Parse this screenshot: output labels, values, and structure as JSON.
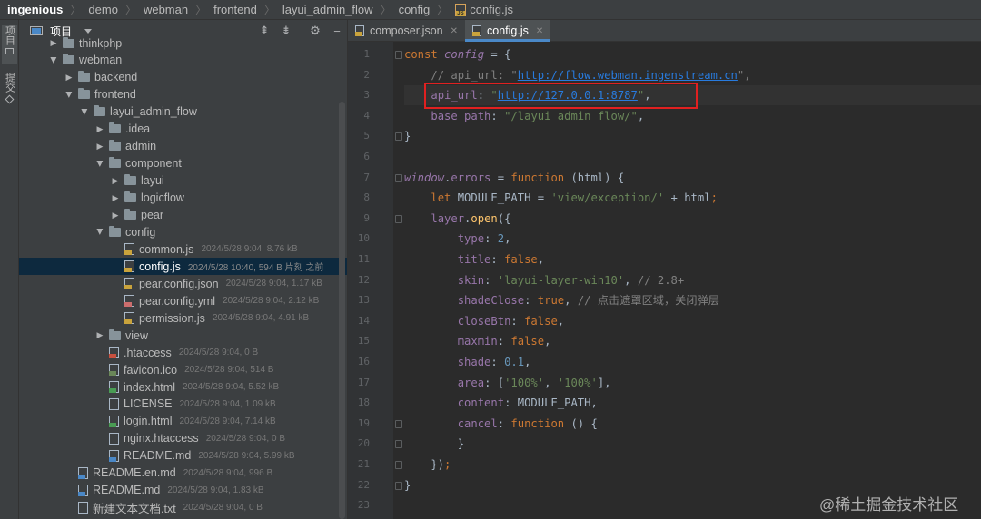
{
  "breadcrumb": [
    "ingenious",
    "demo",
    "webman",
    "frontend",
    "layui_admin_flow",
    "config",
    "config.js"
  ],
  "tool_strip": [
    "项目",
    "提交"
  ],
  "project_panel": {
    "title": "项目",
    "tools": [
      "⇞",
      "⇟",
      "⚙",
      "−"
    ]
  },
  "tree": [
    {
      "name": "thinkphp",
      "meta": "",
      "kind": "folder",
      "depth": 2,
      "open": false
    },
    {
      "name": "webman",
      "meta": "",
      "kind": "folder",
      "depth": 2,
      "open": true
    },
    {
      "name": "backend",
      "meta": "",
      "kind": "folder",
      "depth": 3,
      "open": false
    },
    {
      "name": "frontend",
      "meta": "",
      "kind": "folder",
      "depth": 3,
      "open": true
    },
    {
      "name": "layui_admin_flow",
      "meta": "",
      "kind": "folder",
      "depth": 4,
      "open": true
    },
    {
      "name": ".idea",
      "meta": "",
      "kind": "folder",
      "depth": 5,
      "open": false
    },
    {
      "name": "admin",
      "meta": "",
      "kind": "folder",
      "depth": 5,
      "open": false
    },
    {
      "name": "component",
      "meta": "",
      "kind": "folder",
      "depth": 5,
      "open": true
    },
    {
      "name": "layui",
      "meta": "",
      "kind": "folder",
      "depth": 6,
      "open": false
    },
    {
      "name": "logicflow",
      "meta": "",
      "kind": "folder",
      "depth": 6,
      "open": false
    },
    {
      "name": "pear",
      "meta": "",
      "kind": "folder",
      "depth": 6,
      "open": false
    },
    {
      "name": "config",
      "meta": "",
      "kind": "folder",
      "depth": 5,
      "open": true
    },
    {
      "name": "common.js",
      "meta": "2024/5/28 9:04, 8.76 kB",
      "kind": "js",
      "depth": 6
    },
    {
      "name": "config.js",
      "meta": "2024/5/28 10:40, 594 B 片刻 之前",
      "kind": "js",
      "depth": 6,
      "selected": true
    },
    {
      "name": "pear.config.json",
      "meta": "2024/5/28 9:04, 1.17 kB",
      "kind": "json",
      "depth": 6
    },
    {
      "name": "pear.config.yml",
      "meta": "2024/5/28 9:04, 2.12 kB",
      "kind": "yml",
      "depth": 6
    },
    {
      "name": "permission.js",
      "meta": "2024/5/28 9:04, 4.91 kB",
      "kind": "js",
      "depth": 6
    },
    {
      "name": "view",
      "meta": "",
      "kind": "folder",
      "depth": 5,
      "open": false
    },
    {
      "name": ".htaccess",
      "meta": "2024/5/28 9:04, 0 B",
      "kind": "ht",
      "depth": 5
    },
    {
      "name": "favicon.ico",
      "meta": "2024/5/28 9:04, 514 B",
      "kind": "ico",
      "depth": 5
    },
    {
      "name": "index.html",
      "meta": "2024/5/28 9:04, 5.52 kB",
      "kind": "html",
      "depth": 5
    },
    {
      "name": "LICENSE",
      "meta": "2024/5/28 9:04, 1.09 kB",
      "kind": "txt",
      "depth": 5
    },
    {
      "name": "login.html",
      "meta": "2024/5/28 9:04, 7.14 kB",
      "kind": "html",
      "depth": 5
    },
    {
      "name": "nginx.htaccess",
      "meta": "2024/5/28 9:04, 0 B",
      "kind": "txt",
      "depth": 5
    },
    {
      "name": "README.md",
      "meta": "2024/5/28 9:04, 5.99 kB",
      "kind": "md",
      "depth": 5
    },
    {
      "name": "README.en.md",
      "meta": "2024/5/28 9:04, 996 B",
      "kind": "md",
      "depth": 3
    },
    {
      "name": "README.md",
      "meta": "2024/5/28 9:04, 1.83 kB",
      "kind": "md",
      "depth": 3
    },
    {
      "name": "新建文本文档.txt",
      "meta": "2024/5/28 9:04, 0 B",
      "kind": "txt",
      "depth": 3
    }
  ],
  "tabs": [
    {
      "label": "composer.json",
      "active": false,
      "kind": "json"
    },
    {
      "label": "config.js",
      "active": true,
      "kind": "js"
    }
  ],
  "code_lines": [
    {
      "n": "1",
      "html": "<span class=\"kw\">const </span><span class=\"it\">config</span> = {"
    },
    {
      "n": "2",
      "html": "    <span class=\"cm\">// api_url: \"<span class=\"lk\">http://flow.webman.ingenstream.cn</span>\",</span>"
    },
    {
      "n": "3",
      "html": "    <span class=\"pr\">api_url</span>: <span class=\"st\">\"<span class=\"lk\">http://127.0.0.1:8787</span>\"</span>,",
      "caret": true
    },
    {
      "n": "4",
      "html": "    <span class=\"pr\">base_path</span>: <span class=\"st\">\"/layui_admin_flow/\"</span>,"
    },
    {
      "n": "5",
      "html": "}"
    },
    {
      "n": "6",
      "html": ""
    },
    {
      "n": "7",
      "html": "<span class=\"it\">window</span>.<span class=\"pr\">errors</span> = <span class=\"kw\">function</span> (html) {"
    },
    {
      "n": "8",
      "html": "    <span class=\"kw\">let </span>MODULE_PATH = <span class=\"st\">'view/exception/'</span> + html<span class=\"kw\">;</span>"
    },
    {
      "n": "9",
      "html": "    <span class=\"pr\">layer</span>.<span class=\"fn\">open</span>({"
    },
    {
      "n": "10",
      "html": "        <span class=\"pr\">type</span>: <span class=\"num\">2</span>,"
    },
    {
      "n": "11",
      "html": "        <span class=\"pr\">title</span>: <span class=\"kw\">false</span>,"
    },
    {
      "n": "12",
      "html": "        <span class=\"pr\">skin</span>: <span class=\"st\">'layui-layer-win10'</span>, <span class=\"cm\">// 2.8+</span>"
    },
    {
      "n": "13",
      "html": "        <span class=\"pr\">shadeClose</span>: <span class=\"kw\">true</span>, <span class=\"cm\">// 点击遮罩区域，关闭弹层</span>"
    },
    {
      "n": "14",
      "html": "        <span class=\"pr\">closeBtn</span>: <span class=\"kw\">false</span>,"
    },
    {
      "n": "15",
      "html": "        <span class=\"pr\">maxmin</span>: <span class=\"kw\">false</span>,"
    },
    {
      "n": "16",
      "html": "        <span class=\"pr\">shade</span>: <span class=\"num\">0.1</span>,"
    },
    {
      "n": "17",
      "html": "        <span class=\"pr\">area</span>: [<span class=\"st\">'100%'</span>, <span class=\"st\">'100%'</span>],"
    },
    {
      "n": "18",
      "html": "        <span class=\"pr\">content</span>: MODULE_PATH,"
    },
    {
      "n": "19",
      "html": "        <span class=\"pr\">cancel</span>: <span class=\"kw\">function</span> () {"
    },
    {
      "n": "20",
      "html": "        }"
    },
    {
      "n": "21",
      "html": "    })<span class=\"kw\">;</span>"
    },
    {
      "n": "22",
      "html": "}"
    },
    {
      "n": "23",
      "html": ""
    }
  ],
  "watermark": "@稀土掘金技术社区",
  "colors": {
    "highlight_box": "#e02020",
    "selection": "#0d293e",
    "accent": "#4a88c7"
  }
}
